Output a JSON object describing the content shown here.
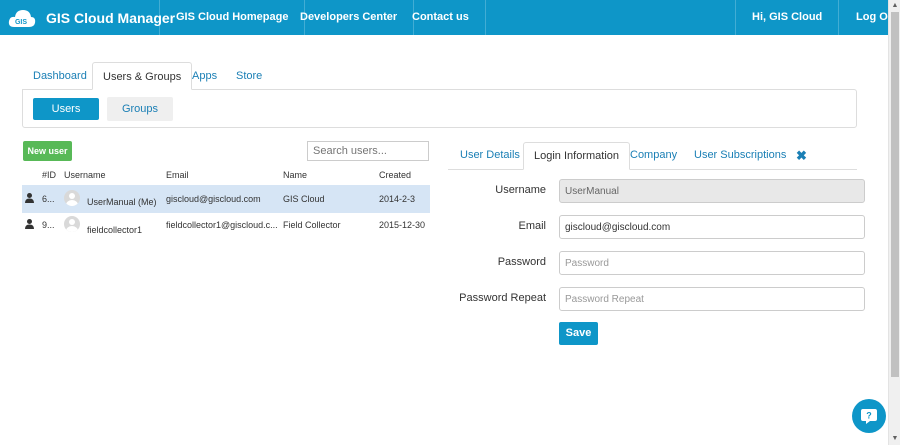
{
  "header": {
    "brand": "GIS Cloud Manager",
    "logo_text": "GIS",
    "nav": [
      "GIS Cloud Homepage",
      "Developers Center",
      "Contact us"
    ],
    "greeting": "Hi, GIS Cloud",
    "logout": "Log Out"
  },
  "main_tabs": [
    "Dashboard",
    "Users & Groups",
    "Apps",
    "Store"
  ],
  "active_main_tab": "Users & Groups",
  "sub_tabs": {
    "users": "Users",
    "groups": "Groups"
  },
  "users_list": {
    "new_user_label": "New user",
    "search_placeholder": "Search users...",
    "columns": [
      "#ID",
      "Username",
      "Email",
      "Name",
      "Created"
    ],
    "rows": [
      {
        "id": "6...",
        "username": "UserManual (Me)",
        "email": "giscloud@giscloud.com",
        "name": "GIS Cloud",
        "created": "2014-2-3",
        "selected": true
      },
      {
        "id": "9...",
        "username": "fieldcollector1",
        "email": "fieldcollector1@giscloud.c...",
        "name": "Field Collector",
        "created": "2015-12-30",
        "selected": false
      }
    ]
  },
  "details": {
    "tabs": [
      "User Details",
      "Login Information",
      "Company",
      "User Subscriptions"
    ],
    "active_tab": "Login Information",
    "close_glyph": "✖",
    "fields": {
      "username": {
        "label": "Username",
        "value": "UserManual"
      },
      "email": {
        "label": "Email",
        "value": "giscloud@giscloud.com"
      },
      "password": {
        "label": "Password",
        "placeholder": "Password"
      },
      "password_repeat": {
        "label": "Password Repeat",
        "placeholder": "Password Repeat"
      }
    },
    "save_label": "Save"
  },
  "icons": {
    "logo": "gis-cloud-logo",
    "user": "person-icon",
    "avatar": "default-avatar-icon",
    "close": "close-icon",
    "chat": "chat-help-icon"
  },
  "colors": {
    "brand_blue": "#0e96c8",
    "link_blue": "#1a7fb5",
    "success_green": "#58b957",
    "selected_row": "#d6e5f5"
  }
}
